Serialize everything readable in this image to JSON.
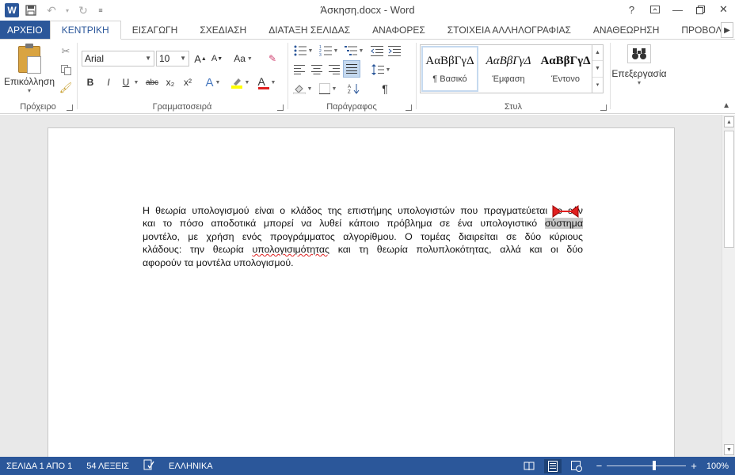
{
  "window": {
    "title": "Άσκηση.docx - Word",
    "app_icon": "W",
    "help": "?"
  },
  "tabs": [
    "ΑΡΧΕΙΟ",
    "ΚΕΝΤΡΙΚΗ",
    "ΕΙΣΑΓΩΓΗ",
    "ΣΧΕΔΙΑΣΗ",
    "ΔΙΑΤΑΞΗ ΣΕΛΙΔΑΣ",
    "ΑΝΑΦΟΡΕΣ",
    "ΣΤΟΙΧΕΙΑ ΑΛΛΗΛΟΓΡΑΦΙΑΣ",
    "ΑΝΑΘΕΩΡΗΣΗ",
    "ΠΡΟΒΟΛΗ"
  ],
  "active_tab": "ΚΕΝΤΡΙΚΗ",
  "ribbon": {
    "clipboard": {
      "paste_label": "Επικόλληση",
      "group_label": "Πρόχειρο"
    },
    "font": {
      "font_name": "Arial",
      "font_size": "10",
      "group_label": "Γραμματοσειρά",
      "bold": "B",
      "italic": "I",
      "underline": "U",
      "strike": "abc",
      "subscript": "x₂",
      "superscript": "x²",
      "grow": "A",
      "shrink": "A",
      "case": "Aa"
    },
    "paragraph": {
      "group_label": "Παράγραφος",
      "pilcrow": "¶"
    },
    "styles": {
      "group_label": "Στυλ",
      "items": [
        {
          "sample": "ΑαΒβΓγΔ",
          "name": "¶ Βασικό"
        },
        {
          "sample": "ΑαΒβΓγΔ",
          "name": "Έμφαση"
        },
        {
          "sample": "ΑαΒβΓγΔ",
          "name": "Έντονο"
        }
      ]
    },
    "editing": {
      "label": "Επεξεργασία"
    }
  },
  "document": {
    "lines": [
      "Η θεωρία υπολογισμού είναι ο κλάδος της επιστήμης υπολογιστών που πραγματεύεται το εάν",
      "και το πόσο αποδοτικά μπορεί να λυθεί κάποιο πρόβλημα σε ένα υπολογιστικό ",
      "μοντέλο, με χρήση ενός προγράμματος αλγορίθμου. Ο τομέας διαιρείται σε δύο κύριους",
      "κλάδους: την θεωρία ",
      "αφορούν τα μοντέλα υπολογισμού."
    ],
    "highlighted_word": "σύστημα",
    "misspelled_word": "υπολογισιμότητας",
    "line4_rest": " και τη θεωρία πολυπλοκότητας, αλλά και οι δύο"
  },
  "status": {
    "page": "ΣΕΛΙΔΑ 1 ΑΠΟ 1",
    "words": "54 ΛΕΞΕΙΣ",
    "language": "ΕΛΛΗΝΙΚΑ",
    "zoom": "100%",
    "zoom_minus": "−",
    "zoom_plus": "+"
  },
  "colors": {
    "accent": "#2b579a",
    "highlight": "#ffff00",
    "font_color": "#e02020"
  }
}
